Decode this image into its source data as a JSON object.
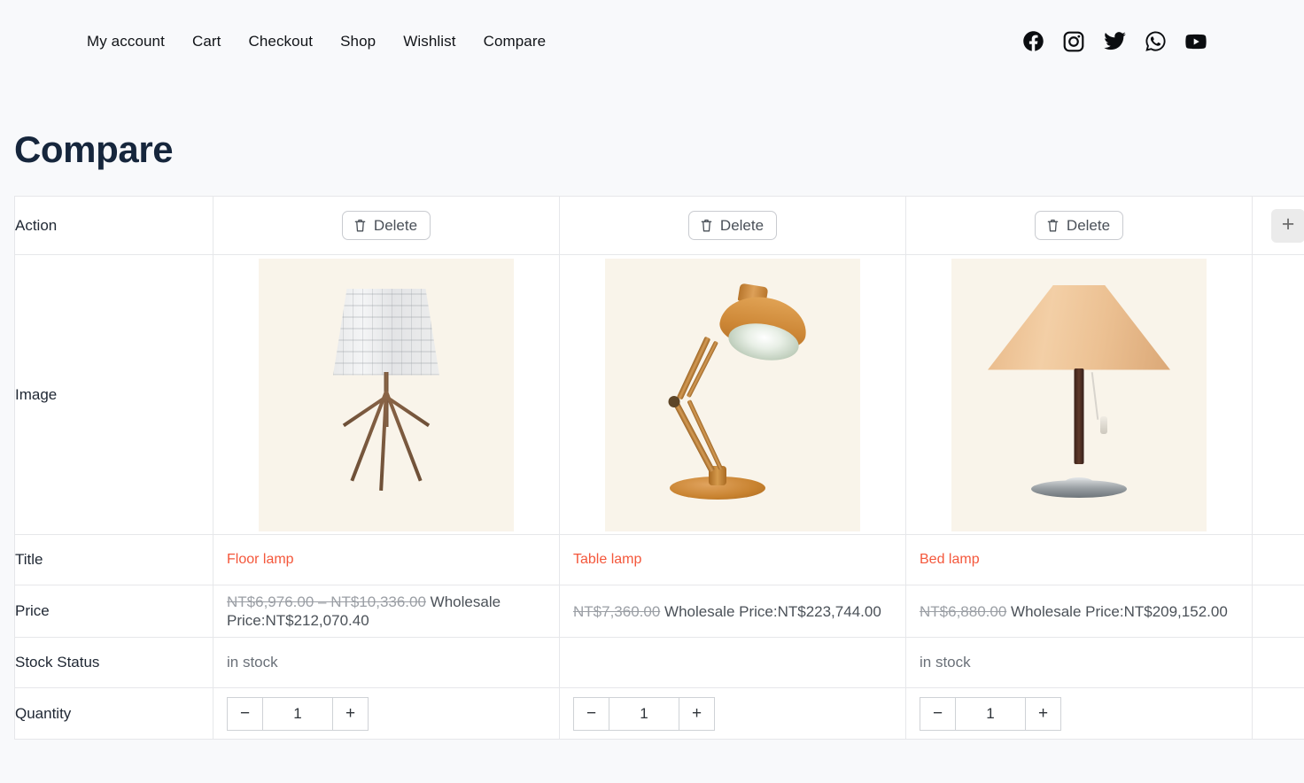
{
  "header": {
    "nav": [
      {
        "label": "My account",
        "name": "nav-my-account"
      },
      {
        "label": "Cart",
        "name": "nav-cart"
      },
      {
        "label": "Checkout",
        "name": "nav-checkout"
      },
      {
        "label": "Shop",
        "name": "nav-shop"
      },
      {
        "label": "Wishlist",
        "name": "nav-wishlist"
      },
      {
        "label": "Compare",
        "name": "nav-compare"
      }
    ],
    "social": [
      {
        "icon": "facebook-icon"
      },
      {
        "icon": "instagram-icon"
      },
      {
        "icon": "twitter-icon"
      },
      {
        "icon": "whatsapp-icon"
      },
      {
        "icon": "youtube-icon"
      }
    ]
  },
  "page": {
    "title": "Compare"
  },
  "table": {
    "row_labels": {
      "action": "Action",
      "image": "Image",
      "title": "Title",
      "price": "Price",
      "stock": "Stock Status",
      "quantity": "Quantity"
    },
    "delete_label": "Delete",
    "add_column_label": "+",
    "qty_minus_label": "−",
    "qty_plus_label": "+",
    "products": [
      {
        "delete_label": "Delete",
        "title": "Floor lamp",
        "image_alt": "floor-lamp-image",
        "price_old": "NT$6,976.00 – NT$10,336.00",
        "price_wholesale": "Wholesale Price:NT$212,070.40",
        "stock": "in stock",
        "quantity": "1"
      },
      {
        "delete_label": "Delete",
        "title": "Table lamp",
        "image_alt": "table-lamp-image",
        "price_old": "NT$7,360.00",
        "price_wholesale": "Wholesale Price:NT$223,744.00",
        "stock": "",
        "quantity": "1"
      },
      {
        "delete_label": "Delete",
        "title": "Bed lamp",
        "image_alt": "bed-lamp-image",
        "price_old": "NT$6,880.00",
        "price_wholesale": "Wholesale Price:NT$209,152.00",
        "stock": "in stock",
        "quantity": "1"
      }
    ]
  },
  "colors": {
    "page_background": "#f8f9fb",
    "title": "#16263c",
    "product_title": "#f4573b",
    "border": "#e6e7ea",
    "thumb_background": "#f9f4ea"
  }
}
